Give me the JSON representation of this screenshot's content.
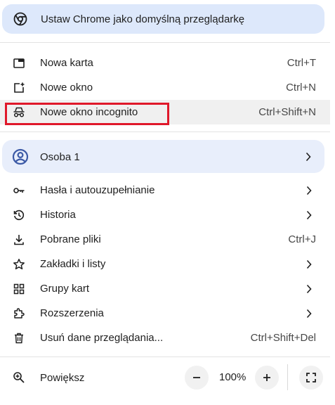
{
  "banner": {
    "label": "Ustaw Chrome jako domyślną przeglądarkę",
    "icon": "chrome-icon"
  },
  "group1": [
    {
      "label": "Nowa karta",
      "shortcut": "Ctrl+T",
      "icon": "new-tab-icon"
    },
    {
      "label": "Nowe okno",
      "shortcut": "Ctrl+N",
      "icon": "new-window-icon"
    },
    {
      "label": "Nowe okno incognito",
      "shortcut": "Ctrl+Shift+N",
      "icon": "incognito-icon"
    }
  ],
  "profile": {
    "label": "Osoba 1",
    "icon": "account-icon"
  },
  "group2": [
    {
      "label": "Hasła i autouzupełnianie",
      "icon": "key-icon"
    },
    {
      "label": "Historia",
      "icon": "history-icon"
    },
    {
      "label": "Pobrane pliki",
      "shortcut": "Ctrl+J",
      "icon": "download-icon"
    },
    {
      "label": "Zakładki i listy",
      "icon": "star-icon"
    },
    {
      "label": "Grupy kart",
      "icon": "tab-groups-icon"
    },
    {
      "label": "Rozszerzenia",
      "icon": "extension-icon"
    },
    {
      "label": "Usuń dane przeglądania...",
      "shortcut": "Ctrl+Shift+Del",
      "icon": "trash-icon"
    }
  ],
  "zoom": {
    "label": "Powiększ",
    "value": "100%",
    "icon": "zoom-icon"
  },
  "colors": {
    "banner_bg": "#dde8fb",
    "profile_bg": "#e8eefb",
    "highlight": "#e0182a",
    "hover_bg": "#f0f0f0"
  }
}
